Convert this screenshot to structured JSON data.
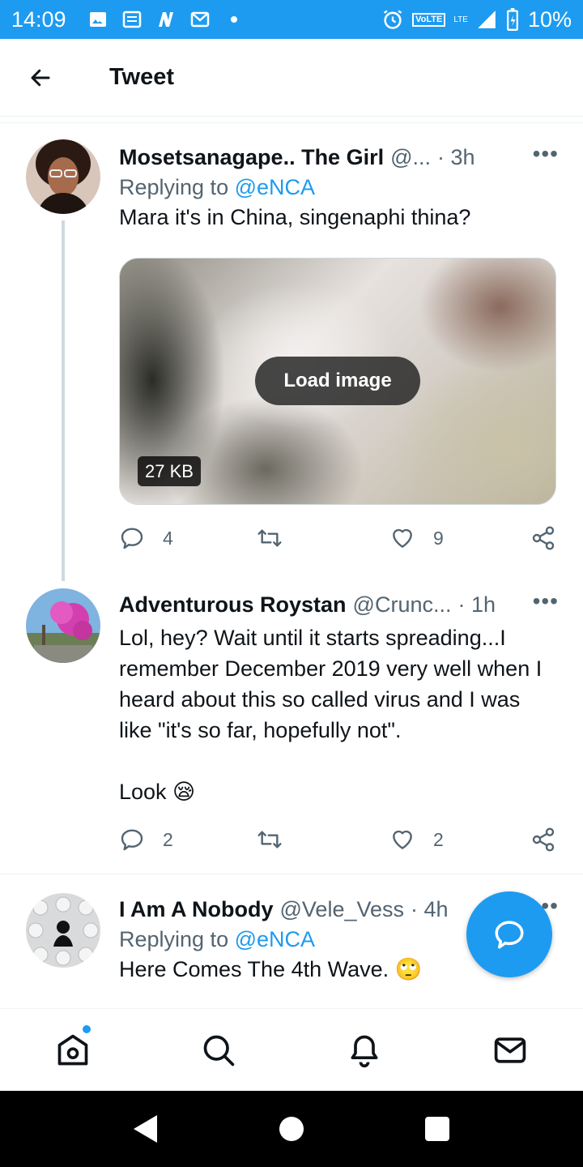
{
  "status_bar": {
    "time": "14:09",
    "battery": "10%",
    "network": "VoLTE",
    "lte": "LTE"
  },
  "header": {
    "title": "Tweet",
    "back_icon": "arrow-left-icon"
  },
  "tweets": [
    {
      "name": "Mosetsanagape.. The Girl",
      "handle": "@...",
      "time": "· 3h",
      "more": "•••",
      "replying_prefix": "Replying to ",
      "replying_to": "@eNCA",
      "text": "Mara it's in China, singenaphi thina?",
      "media": {
        "button": "Load image",
        "size": "27 KB"
      },
      "replies": "4",
      "retweets": "",
      "likes": "9"
    },
    {
      "name": "Adventurous Roystan",
      "handle": "@Crunc...",
      "time": "· 1h",
      "more": "•••",
      "text": "Lol, hey? Wait until it starts spreading...I remember December 2019 very well when I heard about this so called virus and I was like \"it's so far, hopefully not\".\n\nLook 😪",
      "replies": "2",
      "retweets": "",
      "likes": "2"
    },
    {
      "name": "I Am A Nobody",
      "handle": "@Vele_Vess",
      "time": "· 4h",
      "more": "•••",
      "replying_prefix": "Replying to ",
      "replying_to": "@eNCA",
      "text": "Here Comes The 4th Wave. 🙄"
    }
  ],
  "colors": {
    "accent": "#1d9bf0",
    "text": "#0f1419",
    "muted": "#536471"
  }
}
